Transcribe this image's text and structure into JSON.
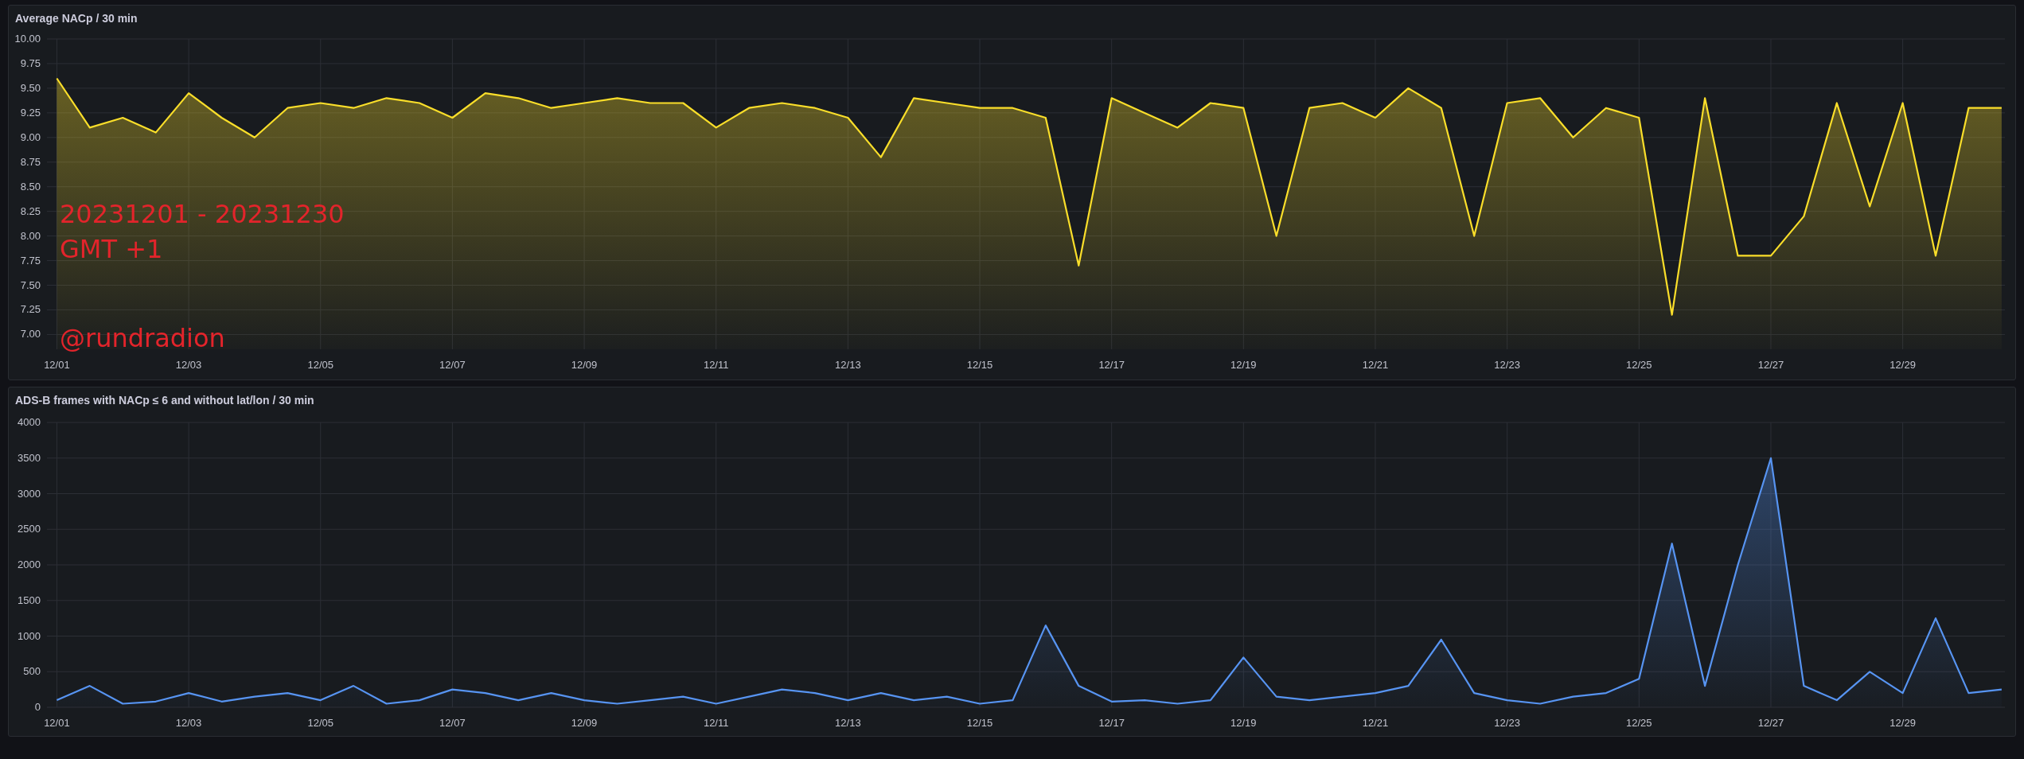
{
  "panels": [
    {
      "title": "Average NACp / 30 min",
      "overlay_text": [
        "20231201 - 20231230",
        "GMT +1",
        "@rundradion"
      ],
      "chart_data": {
        "type": "area",
        "categories": [
          "12/01",
          null,
          null,
          null,
          "12/03",
          null,
          null,
          null,
          "12/05",
          null,
          null,
          null,
          "12/07",
          null,
          null,
          null,
          "12/09",
          null,
          null,
          null,
          "12/11",
          null,
          null,
          null,
          "12/13",
          null,
          null,
          null,
          "12/15",
          null,
          null,
          null,
          "12/17",
          null,
          null,
          null,
          "12/19",
          null,
          null,
          null,
          "12/21",
          null,
          null,
          null,
          "12/23",
          null,
          null,
          null,
          "12/25",
          null,
          null,
          null,
          "12/27",
          null,
          null,
          null,
          "12/29",
          null,
          null,
          null
        ],
        "ylim": [
          6.85,
          10
        ],
        "grid": true,
        "yticks": [
          {
            "value": 7,
            "label": "7.00"
          },
          {
            "value": 7.25,
            "label": "7.25"
          },
          {
            "value": 7.5,
            "label": "7.50"
          },
          {
            "value": 7.75,
            "label": "7.75"
          },
          {
            "value": 8,
            "label": "8.00"
          },
          {
            "value": 8.25,
            "label": "8.25"
          },
          {
            "value": 8.5,
            "label": "8.50"
          },
          {
            "value": 8.75,
            "label": "8.75"
          },
          {
            "value": 9,
            "label": "9.00"
          },
          {
            "value": 9.25,
            "label": "9.25"
          },
          {
            "value": 9.5,
            "label": "9.50"
          },
          {
            "value": 9.75,
            "label": "9.75"
          },
          {
            "value": 10,
            "label": "10.00"
          }
        ],
        "series": [
          {
            "color": "#fade2a",
            "values": [
              9.6,
              9.1,
              9.2,
              9.05,
              9.45,
              9.2,
              9.0,
              9.3,
              9.35,
              9.3,
              9.4,
              9.35,
              9.2,
              9.45,
              9.4,
              9.3,
              9.35,
              9.4,
              9.35,
              9.35,
              9.1,
              9.3,
              9.35,
              9.3,
              9.2,
              8.8,
              9.4,
              9.35,
              9.3,
              9.3,
              9.2,
              7.7,
              9.4,
              9.25,
              9.1,
              9.35,
              9.3,
              8.0,
              9.3,
              9.35,
              9.2,
              9.5,
              9.3,
              8.0,
              9.35,
              9.4,
              9.0,
              9.3,
              9.2,
              7.2,
              9.4,
              7.8,
              7.8,
              8.2,
              9.35,
              8.3,
              9.35,
              7.8,
              9.3,
              9.3
            ]
          }
        ]
      }
    },
    {
      "title": "ADS-B frames with NACp ≤ 6 and without lat/lon / 30 min",
      "chart_data": {
        "type": "area",
        "categories": [
          "12/01",
          null,
          null,
          null,
          "12/03",
          null,
          null,
          null,
          "12/05",
          null,
          null,
          null,
          "12/07",
          null,
          null,
          null,
          "12/09",
          null,
          null,
          null,
          "12/11",
          null,
          null,
          null,
          "12/13",
          null,
          null,
          null,
          "12/15",
          null,
          null,
          null,
          "12/17",
          null,
          null,
          null,
          "12/19",
          null,
          null,
          null,
          "12/21",
          null,
          null,
          null,
          "12/23",
          null,
          null,
          null,
          "12/25",
          null,
          null,
          null,
          "12/27",
          null,
          null,
          null,
          "12/29",
          null,
          null,
          null
        ],
        "ylim": [
          0,
          4000
        ],
        "grid": true,
        "yticks": [
          0,
          500,
          1000,
          1500,
          2000,
          2500,
          3000,
          3500,
          4000
        ],
        "series": [
          {
            "color": "#5794f2",
            "values": [
              100,
              300,
              50,
              80,
              200,
              80,
              150,
              200,
              100,
              300,
              50,
              100,
              250,
              200,
              100,
              200,
              100,
              50,
              100,
              150,
              50,
              150,
              250,
              200,
              100,
              200,
              100,
              150,
              50,
              100,
              1150,
              300,
              80,
              100,
              50,
              100,
              700,
              150,
              100,
              150,
              200,
              300,
              950,
              200,
              100,
              50,
              150,
              200,
              400,
              2300,
              300,
              2000,
              3500,
              300,
              100,
              500,
              200,
              1250,
              200,
              250
            ]
          }
        ]
      }
    }
  ]
}
